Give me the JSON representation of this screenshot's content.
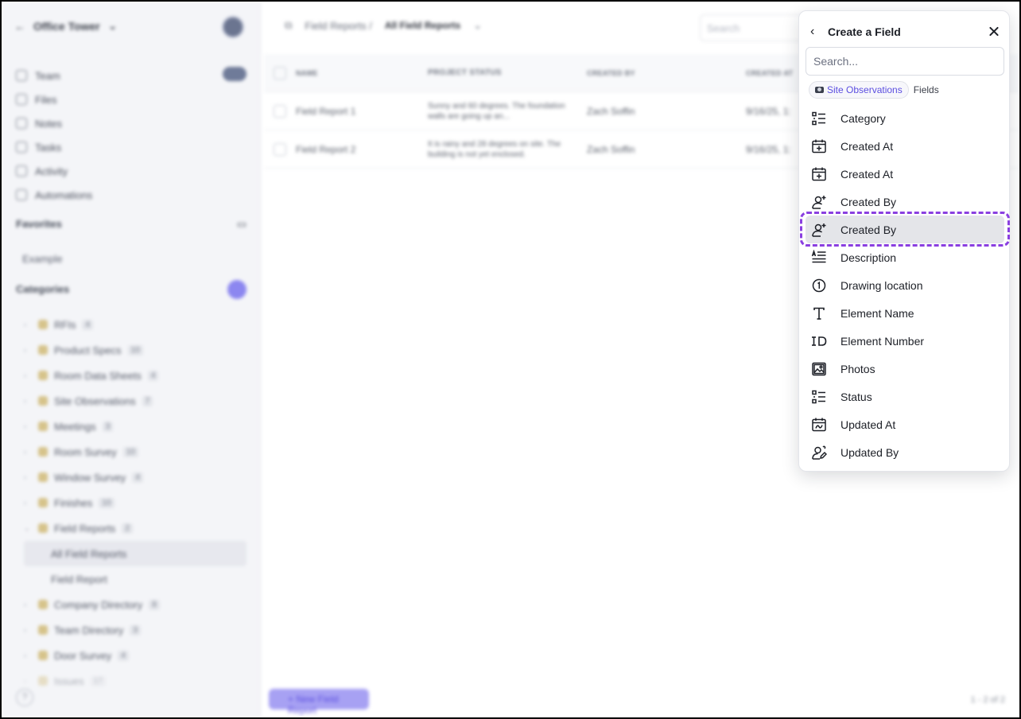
{
  "background": {
    "workspace_name": "Office Tower",
    "nav": [
      "Team",
      "Files",
      "Notes",
      "Tasks",
      "Activity",
      "Automations"
    ],
    "favorites_label": "Favorites",
    "favorites_items": [
      "Example"
    ],
    "categories_label": "Categories",
    "categories": [
      {
        "name": "RFIs",
        "count": "4"
      },
      {
        "name": "Product Specs",
        "count": "10"
      },
      {
        "name": "Room Data Sheets",
        "count": "4"
      },
      {
        "name": "Site Observations",
        "count": "7"
      },
      {
        "name": "Meetings",
        "count": "3"
      },
      {
        "name": "Room Survey",
        "count": "10"
      },
      {
        "name": "Window Survey",
        "count": "4"
      },
      {
        "name": "Finishes",
        "count": "10"
      },
      {
        "name": "Field Reports",
        "count": "2"
      },
      {
        "name": "Company Directory",
        "count": "8"
      },
      {
        "name": "Team Directory",
        "count": "3"
      },
      {
        "name": "Door Survey",
        "count": "4"
      },
      {
        "name": "Issues",
        "count": "17"
      }
    ],
    "field_reports_views": [
      "All Field Reports",
      "Field Report"
    ],
    "breadcrumb_parent": "Field Reports /",
    "breadcrumb_current": "All Field Reports",
    "search_placeholder": "Search",
    "table": {
      "headers": [
        "NAME",
        "PROJECT STATUS",
        "CREATED BY",
        "CREATED AT"
      ],
      "rows": [
        [
          "Field Report 1",
          "Sunny and 60 degrees. The foundation walls are going up an...",
          "Zach Soffin",
          "9/16/25, 1:"
        ],
        [
          "Field Report 2",
          "It is rainy and 28 degrees on site. The building is not yet enclosed.",
          "Zach Soffin",
          "9/16/25, 1:"
        ]
      ]
    },
    "new_button": "+ New Field Report",
    "pager": "1 - 2 of 2"
  },
  "popover": {
    "title": "Create a Field",
    "search_placeholder": "Search...",
    "crumb_chip": "Site Observations",
    "crumb_text": "Fields",
    "fields": [
      {
        "label": "Category",
        "icon": "list-icon"
      },
      {
        "label": "Created At",
        "icon": "calendar-plus-icon"
      },
      {
        "label": "Created At",
        "icon": "calendar-plus-icon"
      },
      {
        "label": "Created By",
        "icon": "user-plus-icon"
      },
      {
        "label": "Created By",
        "icon": "user-plus-icon",
        "highlighted": true
      },
      {
        "label": "Description",
        "icon": "text-lines-icon"
      },
      {
        "label": "Drawing location",
        "icon": "numbered-pin-icon"
      },
      {
        "label": "Element Name",
        "icon": "text-t-icon"
      },
      {
        "label": "Element Number",
        "icon": "id-icon"
      },
      {
        "label": "Photos",
        "icon": "image-icon"
      },
      {
        "label": "Status",
        "icon": "list-icon"
      },
      {
        "label": "Updated At",
        "icon": "calendar-edit-icon"
      },
      {
        "label": "Updated By",
        "icon": "user-edit-icon"
      }
    ],
    "accent_color": "#5b4ee0",
    "highlight_color": "#8a3fe0"
  }
}
